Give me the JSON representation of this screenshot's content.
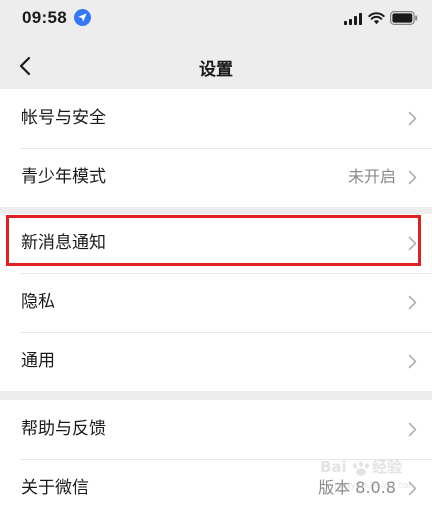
{
  "status_bar": {
    "time": "09:58"
  },
  "nav": {
    "title": "设置"
  },
  "groups": [
    {
      "items": [
        {
          "label": "帐号与安全",
          "value": ""
        },
        {
          "label": "青少年模式",
          "value": "未开启"
        }
      ]
    },
    {
      "items": [
        {
          "label": "新消息通知",
          "value": ""
        },
        {
          "label": "隐私",
          "value": ""
        },
        {
          "label": "通用",
          "value": ""
        }
      ]
    },
    {
      "items": [
        {
          "label": "帮助与反馈",
          "value": ""
        },
        {
          "label": "关于微信",
          "value": "版本 8.0.8"
        }
      ]
    }
  ],
  "highlight": {
    "target": "新消息通知",
    "color": "#e02022"
  },
  "watermark": {
    "brand": "Baidu经验"
  },
  "colors": {
    "background": "#ededed",
    "card": "#ffffff",
    "accent_blue": "#3478f6",
    "secondary_text": "#8a8a8a"
  },
  "icons": {
    "back": "chevron-left-icon",
    "row": "chevron-right-icon",
    "location": "location-arrow-icon",
    "signal": "cellular-signal-icon",
    "wifi": "wifi-icon",
    "battery": "battery-icon"
  }
}
